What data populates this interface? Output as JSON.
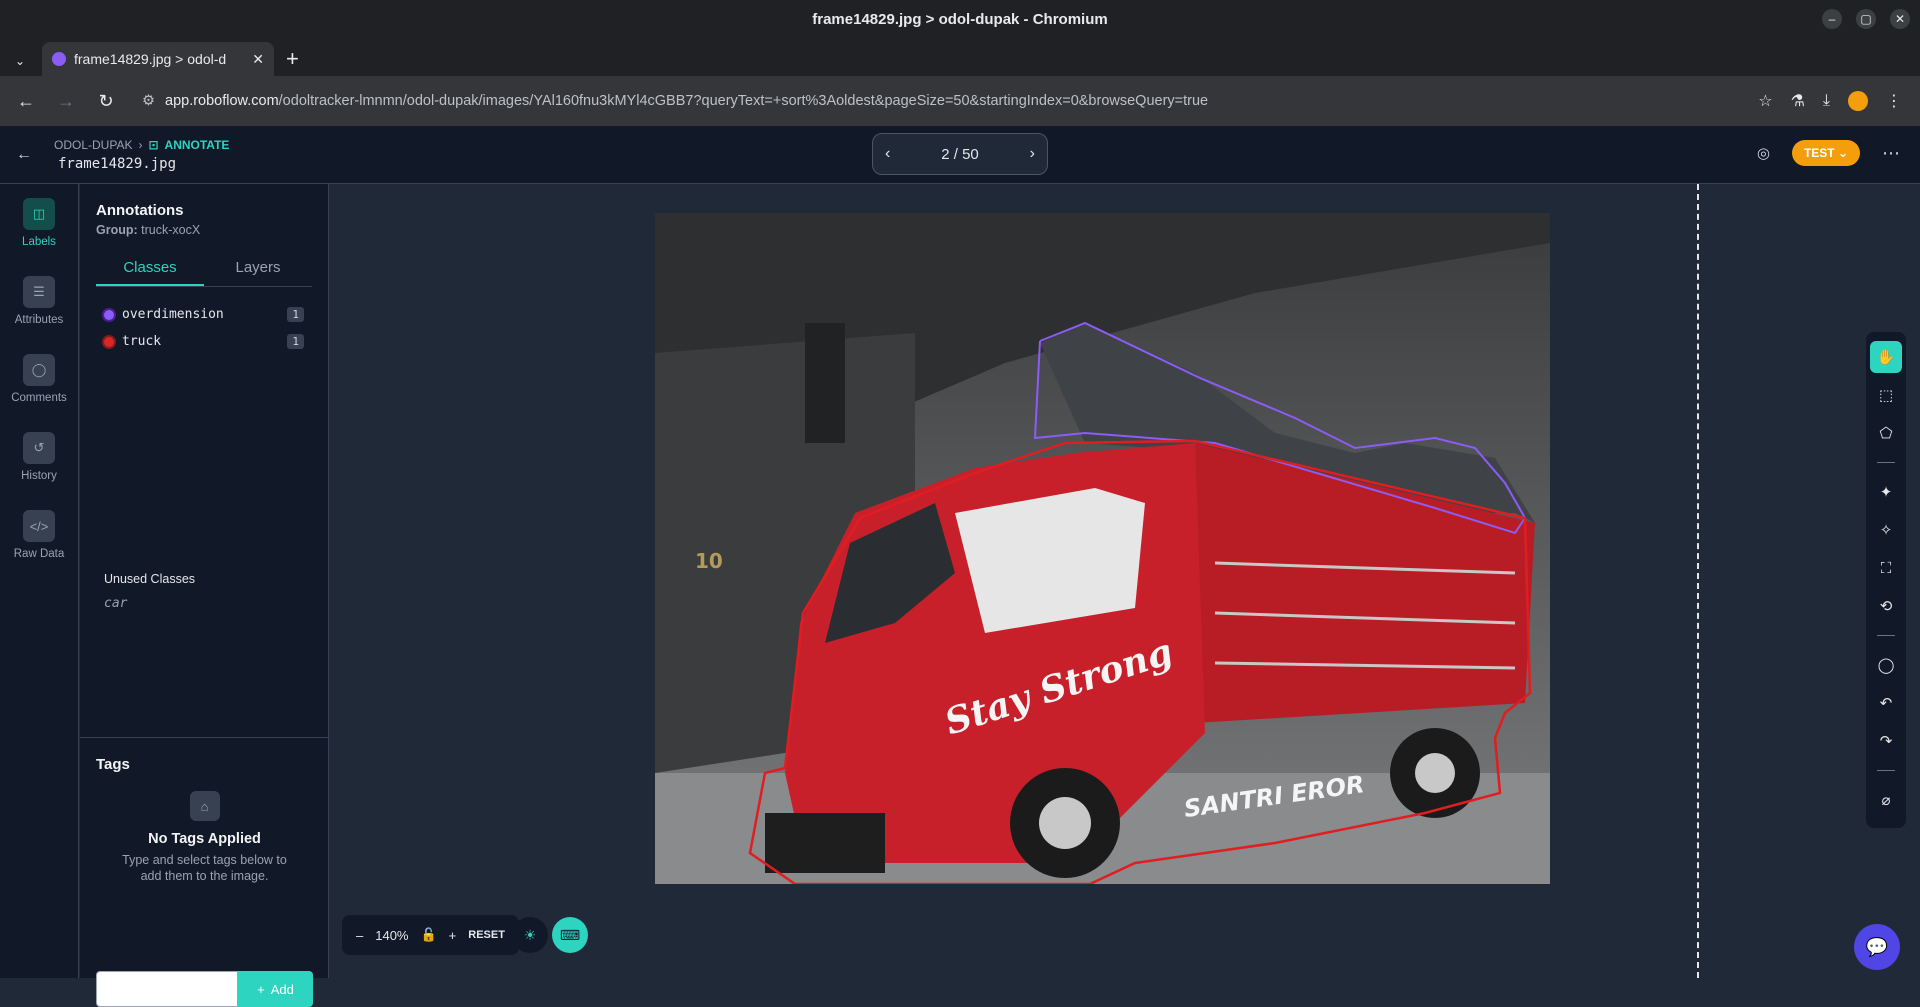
{
  "browser": {
    "window_title": "frame14829.jpg > odol-dupak - Chromium",
    "tab_title": "frame14829.jpg > odol-d",
    "url_host": "app.roboflow.com",
    "url_path": "/odoltracker-lmnmn/odol-dupak/images/YAl160fnu3kMYl4cGBB7?queryText=+sort%3Aoldest&pageSize=50&startingIndex=0&browseQuery=true"
  },
  "header": {
    "project": "ODOL-DUPAK",
    "section": "ANNOTATE",
    "filename": "frame14829.jpg",
    "pager": "2 / 50",
    "test_label": "TEST"
  },
  "rail": {
    "items": [
      {
        "label": "Labels",
        "icon": "tag-icon"
      },
      {
        "label": "Attributes",
        "icon": "list-icon"
      },
      {
        "label": "Comments",
        "icon": "comment-icon"
      },
      {
        "label": "History",
        "icon": "history-icon"
      },
      {
        "label": "Raw Data",
        "icon": "code-icon"
      }
    ]
  },
  "annotations": {
    "title": "Annotations",
    "group_label": "Group:",
    "group_value": "truck-xocX",
    "tabs": [
      "Classes",
      "Layers"
    ],
    "classes": [
      {
        "name": "overdimension",
        "count": "1",
        "color": "#8b5cf6"
      },
      {
        "name": "truck",
        "count": "1",
        "color": "#dc2626"
      }
    ],
    "unused_title": "Unused Classes",
    "unused": [
      "car"
    ]
  },
  "tags": {
    "title": "Tags",
    "empty_title": "No Tags Applied",
    "empty_sub": "Type and select tags below to add them to the image.",
    "add_label": "Add"
  },
  "zoom": {
    "value": "140%",
    "reset": "RESET"
  },
  "image": {
    "plate_number": "10",
    "truck_text": "Stay Strong",
    "truck_text2": "SANTRI EROR"
  }
}
